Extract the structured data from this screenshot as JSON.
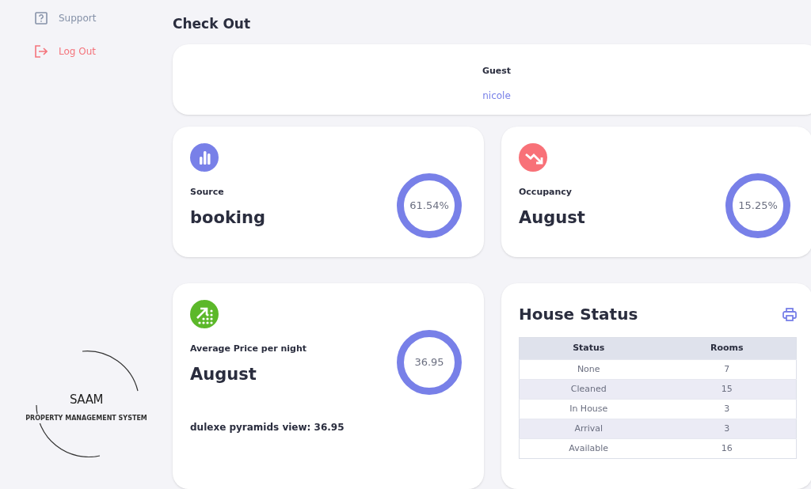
{
  "sidebar": {
    "items": [
      {
        "kind": "support",
        "label": "Support"
      },
      {
        "kind": "logout",
        "label": "Log Out"
      }
    ],
    "logo": {
      "name": "SAAM",
      "tagline": "PROPERTY MANAGEMENT SYSTEM"
    }
  },
  "page_title": "Check Out",
  "guest": {
    "label": "Guest",
    "name": "nicole"
  },
  "stats": [
    {
      "kind": "bars",
      "color": "#7880e8",
      "label": "Source",
      "value": "booking",
      "ring": "61.54%"
    },
    {
      "kind": "trend-down",
      "color": "#f87178",
      "label": "Occupancy",
      "value": "August",
      "ring": "15.25%"
    },
    {
      "kind": "trend-up",
      "color": "#5cb82a",
      "label": "Average Price per night",
      "value": "August",
      "ring": "36.95",
      "note": "dulexe pyramids view: 36.95"
    }
  ],
  "house_status": {
    "title": "House Status",
    "columns": [
      "Status",
      "Rooms"
    ],
    "rows": [
      [
        "None",
        "7"
      ],
      [
        "Cleaned",
        "15"
      ],
      [
        "In House",
        "3"
      ],
      [
        "Arrival",
        "3"
      ],
      [
        "Available",
        "16"
      ]
    ]
  }
}
